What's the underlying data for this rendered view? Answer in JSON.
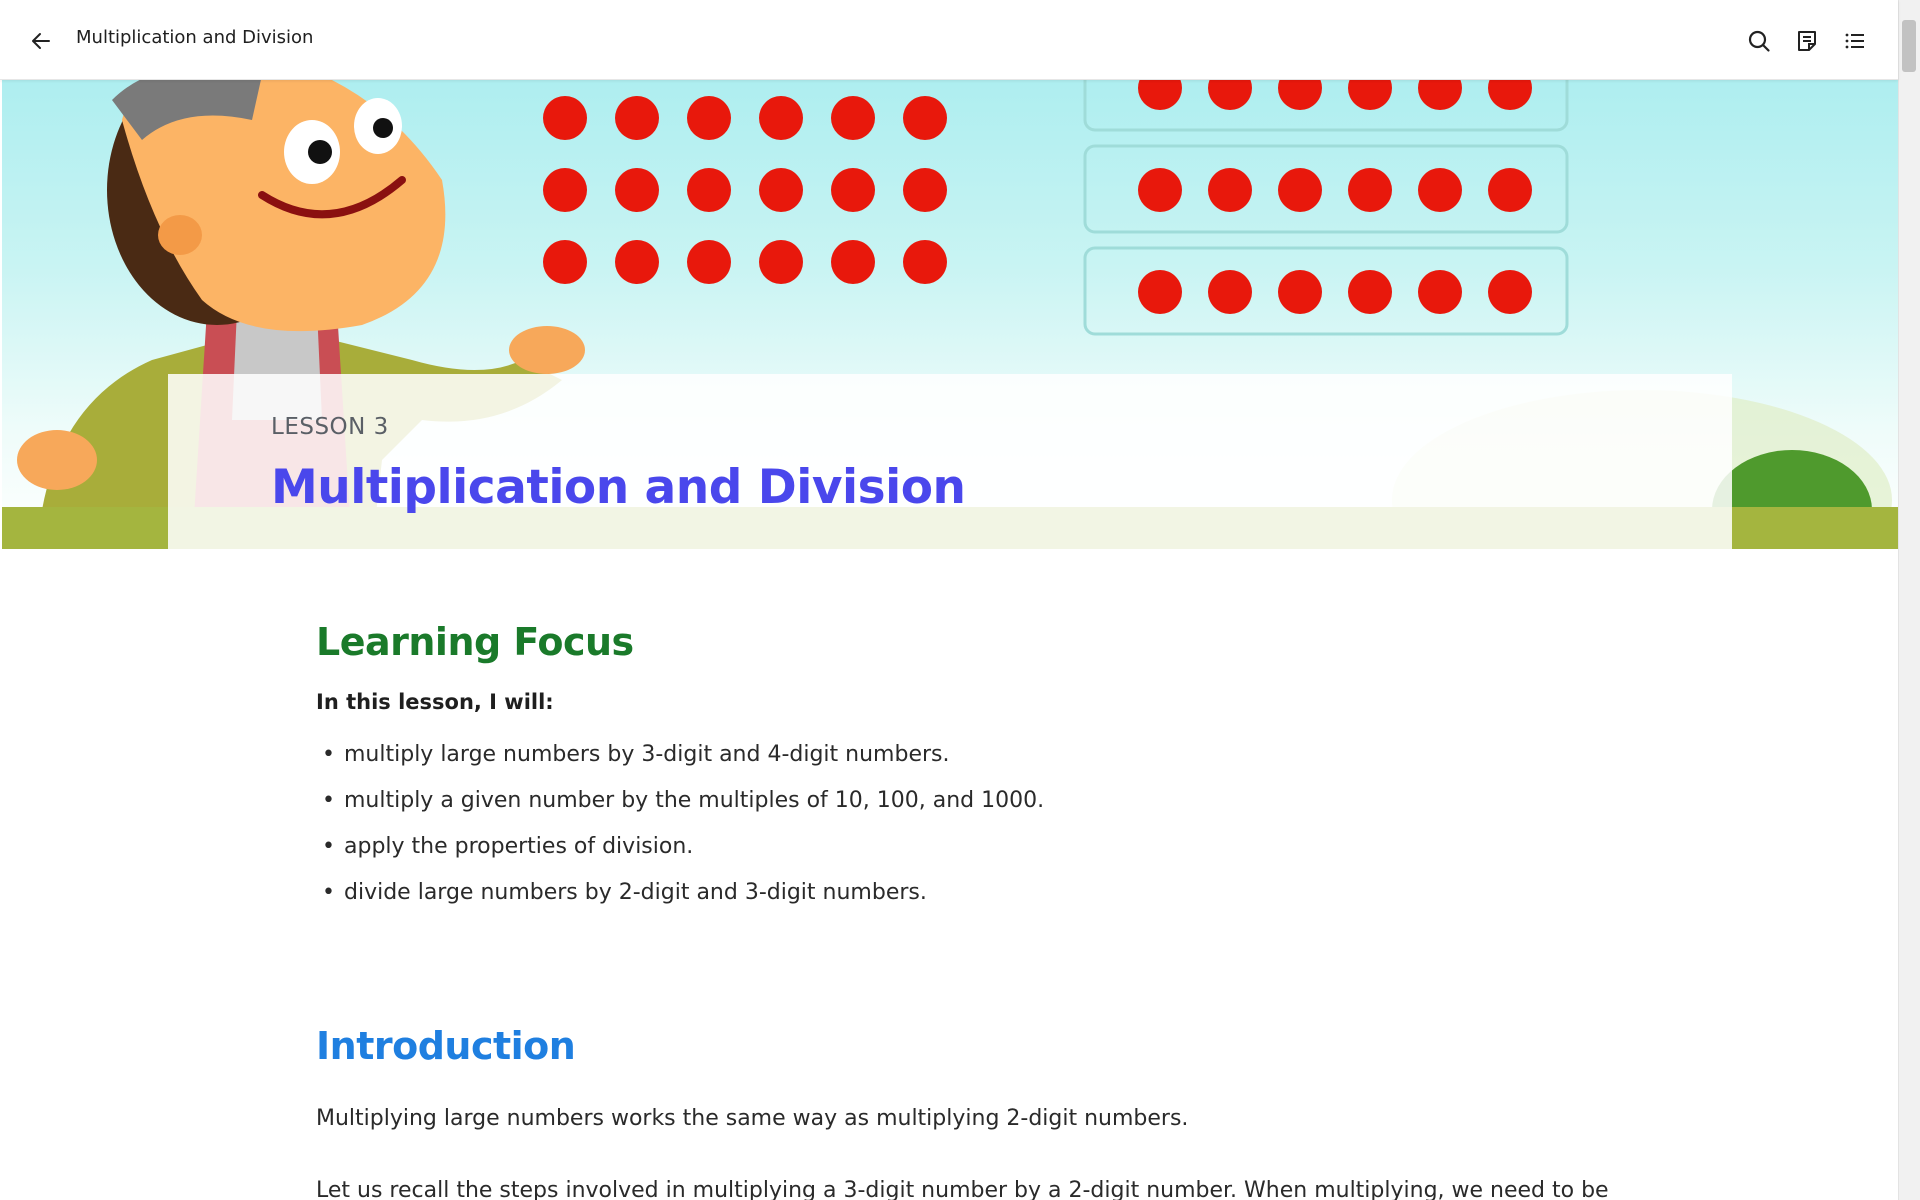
{
  "topbar": {
    "title": "Multiplication and Division",
    "icons": [
      "back-arrow-icon",
      "search-icon",
      "notes-icon",
      "table-of-contents-icon"
    ]
  },
  "banner": {
    "lesson_label": "LESSON 3",
    "lesson_title": "Multiplication and Division",
    "colors": {
      "sky_top": "#aeeef0",
      "ground": "#a4b53f",
      "counter": "#e8180c",
      "title": "#4a47ec"
    }
  },
  "learning_focus": {
    "heading": "Learning Focus",
    "lead": "In this lesson, I will:",
    "items": [
      "multiply large numbers by 3-digit and 4-digit numbers.",
      "multiply a given number by the multiples of 10, 100, and 1000.",
      "apply the properties of division.",
      "divide large numbers by 2-digit and 3-digit numbers."
    ],
    "heading_color": "#1a7a2a"
  },
  "introduction": {
    "heading": "Introduction",
    "paragraph1": "Multiplying large numbers works the same way as multiplying 2-digit numbers.",
    "paragraph2": "Let us recall the steps involved in multiplying a 3-digit number by a 2-digit number. When multiplying, we need to be",
    "heading_color": "#1f7fe0"
  }
}
